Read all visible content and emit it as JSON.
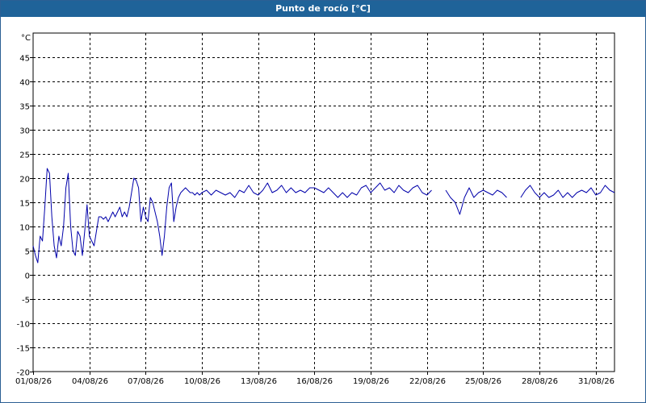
{
  "window": {
    "title": "Punto de rocío [°C]"
  },
  "chart_data": {
    "type": "line",
    "title": "Punto de rocío [°C]",
    "ylabel": "°C",
    "xlabel": "",
    "ylim": [
      -20,
      50
    ],
    "y_ticks": [
      -20,
      -15,
      -10,
      -5,
      0,
      5,
      10,
      15,
      20,
      25,
      30,
      35,
      40,
      45
    ],
    "xlim": [
      "2026-08-01",
      "2026-09-01"
    ],
    "x_ticks": [
      "2026-08-01",
      "2026-08-04",
      "2026-08-07",
      "2026-08-10",
      "2026-08-13",
      "2026-08-16",
      "2026-08-19",
      "2026-08-22",
      "2026-08-25",
      "2026-08-28",
      "2026-08-31"
    ],
    "x_tick_labels": [
      "01/08/26",
      "04/08/26",
      "07/08/26",
      "10/08/26",
      "13/08/26",
      "16/08/26",
      "19/08/26",
      "22/08/26",
      "25/08/26",
      "28/08/26",
      "31/08/26"
    ],
    "grid": true,
    "line_color": "#0000aa",
    "series": [
      {
        "segments": [
          [
            [
              "2026-08-01 00:00",
              6
            ],
            [
              "2026-08-01 03:00",
              4
            ],
            [
              "2026-08-01 06:00",
              2.5
            ],
            [
              "2026-08-01 09:00",
              8
            ],
            [
              "2026-08-01 12:00",
              7
            ],
            [
              "2026-08-01 15:00",
              14
            ],
            [
              "2026-08-01 18:00",
              22
            ],
            [
              "2026-08-01 21:00",
              21
            ],
            [
              "2026-08-02 00:00",
              12
            ],
            [
              "2026-08-02 03:00",
              6
            ],
            [
              "2026-08-02 06:00",
              3.5
            ],
            [
              "2026-08-02 09:00",
              8
            ],
            [
              "2026-08-02 12:00",
              6
            ],
            [
              "2026-08-02 15:00",
              10
            ],
            [
              "2026-08-02 18:00",
              18
            ],
            [
              "2026-08-02 21:00",
              21
            ],
            [
              "2026-08-03 00:00",
              10
            ],
            [
              "2026-08-03 03:00",
              5
            ],
            [
              "2026-08-03 06:00",
              4
            ],
            [
              "2026-08-03 09:00",
              9
            ],
            [
              "2026-08-03 12:00",
              8
            ],
            [
              "2026-08-03 15:00",
              4
            ],
            [
              "2026-08-03 18:00",
              9
            ],
            [
              "2026-08-03 21:00",
              14.5
            ],
            [
              "2026-08-04 00:00",
              8
            ],
            [
              "2026-08-04 03:00",
              7
            ],
            [
              "2026-08-04 06:00",
              6
            ],
            [
              "2026-08-04 09:00",
              9
            ],
            [
              "2026-08-04 12:00",
              12
            ],
            [
              "2026-08-04 15:00",
              12
            ],
            [
              "2026-08-04 18:00",
              11.5
            ],
            [
              "2026-08-04 21:00",
              12
            ],
            [
              "2026-08-05 00:00",
              11
            ],
            [
              "2026-08-05 03:00",
              12
            ],
            [
              "2026-08-05 06:00",
              13
            ],
            [
              "2026-08-05 09:00",
              12
            ],
            [
              "2026-08-05 12:00",
              13
            ],
            [
              "2026-08-05 15:00",
              14
            ],
            [
              "2026-08-05 18:00",
              12
            ],
            [
              "2026-08-05 21:00",
              13
            ],
            [
              "2026-08-06 00:00",
              12
            ],
            [
              "2026-08-06 03:00",
              14
            ],
            [
              "2026-08-06 06:00",
              17
            ],
            [
              "2026-08-06 09:00",
              20
            ],
            [
              "2026-08-06 12:00",
              19.5
            ],
            [
              "2026-08-06 15:00",
              18
            ],
            [
              "2026-08-06 18:00",
              11
            ],
            [
              "2026-08-06 21:00",
              14
            ],
            [
              "2026-08-07 00:00",
              12
            ],
            [
              "2026-08-07 03:00",
              11
            ],
            [
              "2026-08-07 06:00",
              16
            ],
            [
              "2026-08-07 09:00",
              15
            ],
            [
              "2026-08-07 12:00",
              13
            ],
            [
              "2026-08-07 15:00",
              11
            ],
            [
              "2026-08-07 18:00",
              8
            ],
            [
              "2026-08-07 21:00",
              4
            ],
            [
              "2026-08-08 00:00",
              8
            ],
            [
              "2026-08-08 03:00",
              14
            ],
            [
              "2026-08-08 06:00",
              18
            ],
            [
              "2026-08-08 09:00",
              19
            ],
            [
              "2026-08-08 12:00",
              11
            ],
            [
              "2026-08-08 15:00",
              14
            ],
            [
              "2026-08-08 18:00",
              16
            ],
            [
              "2026-08-08 21:00",
              17
            ],
            [
              "2026-08-09 00:00",
              17.5
            ],
            [
              "2026-08-09 03:00",
              18
            ],
            [
              "2026-08-09 06:00",
              17.5
            ],
            [
              "2026-08-09 09:00",
              17
            ],
            [
              "2026-08-09 12:00",
              17
            ],
            [
              "2026-08-09 15:00",
              16.5
            ],
            [
              "2026-08-09 18:00",
              17
            ],
            [
              "2026-08-09 21:00",
              16.5
            ],
            [
              "2026-08-10 00:00",
              17
            ],
            [
              "2026-08-10 06:00",
              17.5
            ],
            [
              "2026-08-10 12:00",
              16.5
            ],
            [
              "2026-08-10 18:00",
              17.5
            ],
            [
              "2026-08-11 00:00",
              17
            ],
            [
              "2026-08-11 06:00",
              16.5
            ],
            [
              "2026-08-11 12:00",
              17
            ],
            [
              "2026-08-11 18:00",
              16
            ],
            [
              "2026-08-12 00:00",
              17.5
            ],
            [
              "2026-08-12 06:00",
              17
            ],
            [
              "2026-08-12 12:00",
              18.5
            ],
            [
              "2026-08-12 18:00",
              17
            ],
            [
              "2026-08-13 00:00",
              16.5
            ],
            [
              "2026-08-13 06:00",
              17.5
            ],
            [
              "2026-08-13 12:00",
              19
            ],
            [
              "2026-08-13 18:00",
              17
            ],
            [
              "2026-08-14 00:00",
              17.5
            ],
            [
              "2026-08-14 06:00",
              18.5
            ],
            [
              "2026-08-14 12:00",
              17
            ],
            [
              "2026-08-14 18:00",
              18
            ],
            [
              "2026-08-15 00:00",
              17
            ],
            [
              "2026-08-15 06:00",
              17.5
            ],
            [
              "2026-08-15 12:00",
              17
            ],
            [
              "2026-08-15 18:00",
              18
            ],
            [
              "2026-08-16 00:00",
              18
            ],
            [
              "2026-08-16 06:00",
              17.5
            ],
            [
              "2026-08-16 12:00",
              17
            ],
            [
              "2026-08-16 18:00",
              18
            ],
            [
              "2026-08-17 00:00",
              17
            ],
            [
              "2026-08-17 06:00",
              16
            ],
            [
              "2026-08-17 12:00",
              17
            ],
            [
              "2026-08-17 18:00",
              16
            ],
            [
              "2026-08-18 00:00",
              17
            ],
            [
              "2026-08-18 06:00",
              16.5
            ],
            [
              "2026-08-18 12:00",
              18
            ],
            [
              "2026-08-18 18:00",
              18.5
            ],
            [
              "2026-08-19 00:00",
              17
            ],
            [
              "2026-08-19 06:00",
              18
            ],
            [
              "2026-08-19 12:00",
              19
            ],
            [
              "2026-08-19 18:00",
              17.5
            ],
            [
              "2026-08-20 00:00",
              18
            ],
            [
              "2026-08-20 06:00",
              17
            ],
            [
              "2026-08-20 12:00",
              18.5
            ],
            [
              "2026-08-20 18:00",
              17.5
            ],
            [
              "2026-08-21 00:00",
              17
            ],
            [
              "2026-08-21 06:00",
              18
            ],
            [
              "2026-08-21 12:00",
              18.5
            ],
            [
              "2026-08-21 18:00",
              17
            ],
            [
              "2026-08-22 00:00",
              16.5
            ],
            [
              "2026-08-22 06:00",
              17.5
            ]
          ],
          [
            [
              "2026-08-23 00:00",
              17.5
            ],
            [
              "2026-08-23 06:00",
              16
            ],
            [
              "2026-08-23 12:00",
              15
            ],
            [
              "2026-08-23 18:00",
              12.5
            ],
            [
              "2026-08-24 00:00",
              16
            ],
            [
              "2026-08-24 06:00",
              18
            ],
            [
              "2026-08-24 12:00",
              16
            ],
            [
              "2026-08-24 18:00",
              17
            ],
            [
              "2026-08-25 00:00",
              17.5
            ],
            [
              "2026-08-25 06:00",
              17
            ],
            [
              "2026-08-25 12:00",
              16.5
            ],
            [
              "2026-08-25 18:00",
              17.5
            ],
            [
              "2026-08-26 00:00",
              17
            ],
            [
              "2026-08-26 06:00",
              16
            ]
          ],
          [
            [
              "2026-08-27 00:00",
              16
            ],
            [
              "2026-08-27 06:00",
              17.5
            ],
            [
              "2026-08-27 12:00",
              18.5
            ],
            [
              "2026-08-27 18:00",
              17
            ],
            [
              "2026-08-28 00:00",
              16
            ],
            [
              "2026-08-28 06:00",
              17
            ],
            [
              "2026-08-28 12:00",
              16
            ],
            [
              "2026-08-28 18:00",
              16.5
            ],
            [
              "2026-08-29 00:00",
              17.5
            ],
            [
              "2026-08-29 06:00",
              16
            ],
            [
              "2026-08-29 12:00",
              17
            ],
            [
              "2026-08-29 18:00",
              16
            ],
            [
              "2026-08-30 00:00",
              17
            ],
            [
              "2026-08-30 06:00",
              17.5
            ],
            [
              "2026-08-30 12:00",
              17
            ],
            [
              "2026-08-30 18:00",
              18
            ],
            [
              "2026-08-31 00:00",
              16.5
            ],
            [
              "2026-08-31 06:00",
              17
            ],
            [
              "2026-08-31 12:00",
              18.5
            ],
            [
              "2026-08-31 18:00",
              17.5
            ],
            [
              "2026-09-01 00:00",
              17
            ]
          ]
        ]
      }
    ]
  }
}
